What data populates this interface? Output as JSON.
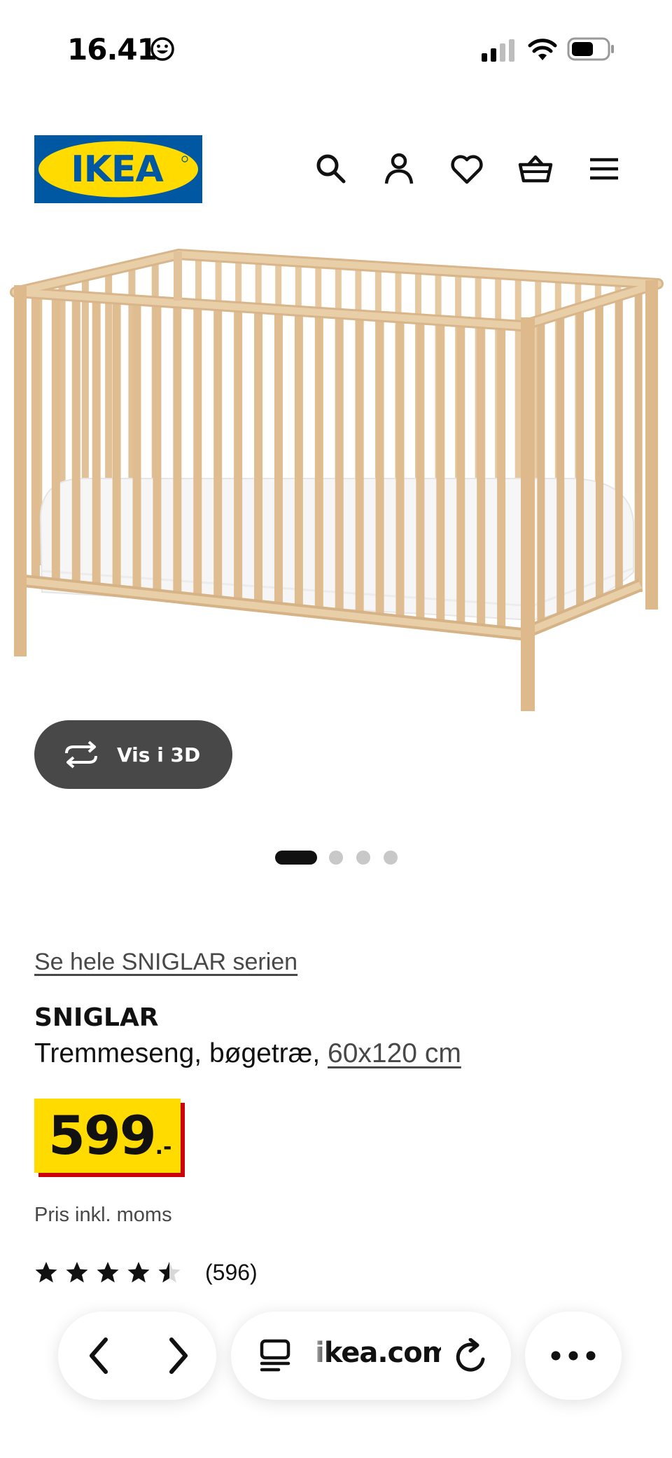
{
  "status_bar": {
    "time": "16.41",
    "emoji_icon": "smiley-face-icon",
    "signal_icon": "cellular-signal-icon",
    "wifi_icon": "wifi-icon",
    "battery_icon": "battery-icon"
  },
  "header": {
    "logo_text": "IKEA",
    "logo_colors": {
      "background": "#0058a3",
      "oval": "#ffdb00",
      "text": "#0058a3"
    },
    "icons": [
      "search-icon",
      "account-icon",
      "heart-icon",
      "shopping-basket-icon",
      "menu-icon"
    ]
  },
  "product_image": {
    "view_3d_label": "Vis i 3D",
    "carousel": {
      "total": 4,
      "active": 1
    }
  },
  "product": {
    "series_link": "Se hele SNIGLAR serien",
    "name": "SNIGLAR",
    "description": "Tremmeseng, bøgetræ, ",
    "size_link": "60x120 cm",
    "price_integer": "599",
    "price_suffix": ".-",
    "price_colors": {
      "tag": "#ffdb00",
      "shadow": "#cc0008"
    },
    "vat_note": "Pris inkl. moms",
    "rating_value": 4.5,
    "rating_max": 5,
    "review_count": "(596)"
  },
  "browser": {
    "url": "ikea.com",
    "back_icon": "chevron-left-icon",
    "forward_icon": "chevron-right-icon",
    "reader_icon": "reader-mode-icon",
    "reload_icon": "reload-icon",
    "more_icon": "more-dots-icon"
  }
}
